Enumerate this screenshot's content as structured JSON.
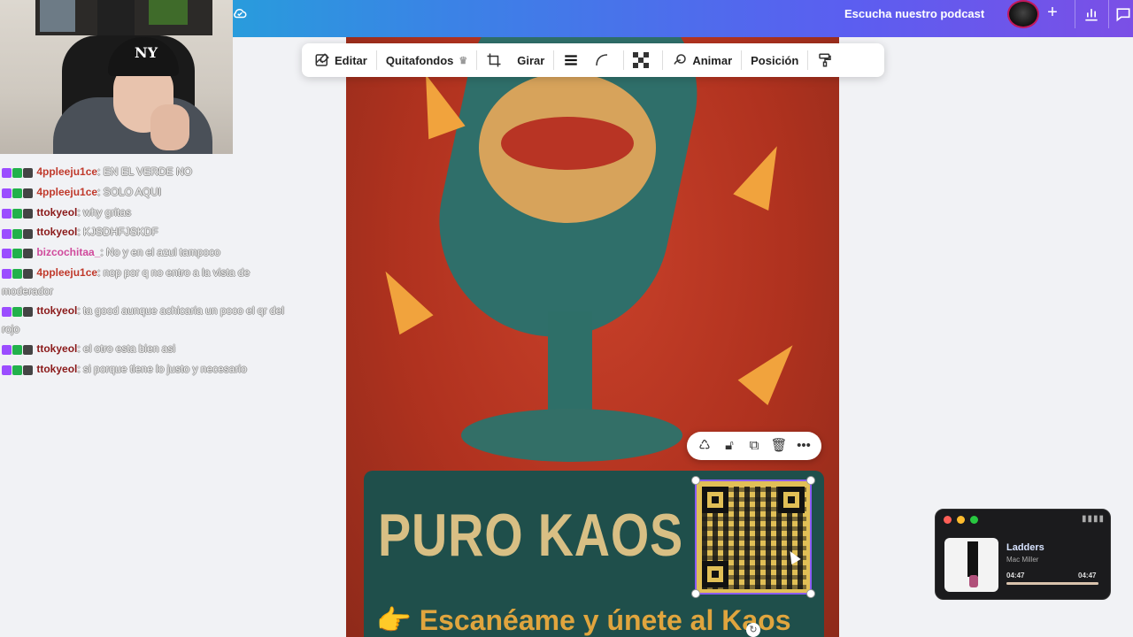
{
  "header": {
    "podcast_label": "Escucha nuestro podcast",
    "plus_label": "+"
  },
  "toolbar": {
    "edit": "Editar",
    "bg_remover": "Quitafondos",
    "rotate": "Girar",
    "animate": "Animar",
    "position": "Posición"
  },
  "chat": [
    {
      "user": "4ppleeju1ce",
      "color": "#c0392b",
      "text": ": EN EL VERDE NO"
    },
    {
      "user": "4ppleeju1ce",
      "color": "#c0392b",
      "text": ": SOLO AQUI"
    },
    {
      "user": "ttokyeol",
      "color": "#8b1a1a",
      "text": ": why gritas"
    },
    {
      "user": "ttokyeol",
      "color": "#8b1a1a",
      "text": ": KJSDHFJSKDF"
    },
    {
      "user": "bizcochitaa_",
      "color": "#d04a9c",
      "text": ": No y en el azul tampoco"
    },
    {
      "user": "4ppleeju1ce",
      "color": "#c0392b",
      "text": ": nop por q no entro a la vista de moderador"
    },
    {
      "user": "ttokyeol",
      "color": "#8b1a1a",
      "text": ": ta good aunque achicaria un poco el qr del rojo"
    },
    {
      "user": "ttokyeol",
      "color": "#8b1a1a",
      "text": ": el otro esta bien asi"
    },
    {
      "user": "ttokyeol",
      "color": "#8b1a1a",
      "text": ": si porque tiene lo justo y necesario"
    }
  ],
  "poster": {
    "title": "PURO KAOS",
    "subtitle": "👉 Escanéame y únete al Kaos"
  },
  "webcam": {
    "cap_logo": "NY"
  },
  "music": {
    "song": "Ladders",
    "artist": "Mac Miller",
    "time_elapsed": "04:47",
    "time_total": "04:47",
    "progress": 1.0
  },
  "colors": {
    "accent": "#8b5cf6",
    "poster_red": "#b0321f",
    "poster_teal": "#1f4f4b"
  }
}
